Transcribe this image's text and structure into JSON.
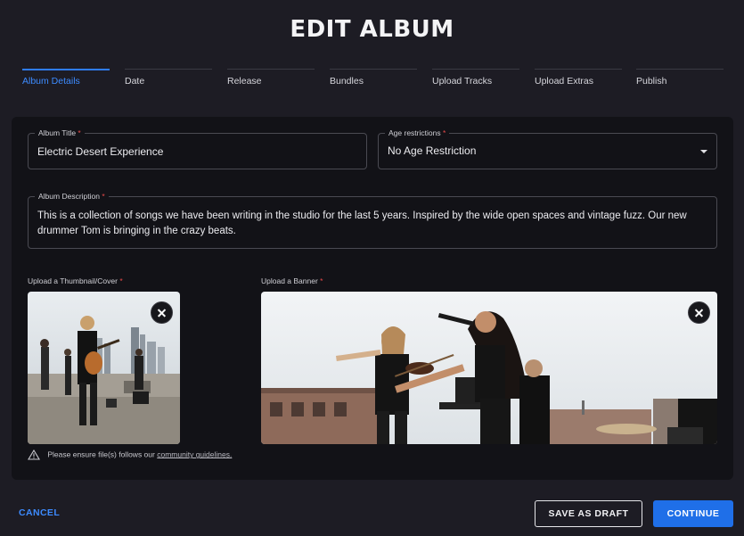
{
  "page": {
    "title": "EDIT ALBUM"
  },
  "steps": [
    {
      "label": "Album Details",
      "active": true
    },
    {
      "label": "Date"
    },
    {
      "label": "Release"
    },
    {
      "label": "Bundles"
    },
    {
      "label": "Upload Tracks"
    },
    {
      "label": "Upload Extras"
    },
    {
      "label": "Publish"
    }
  ],
  "form": {
    "album_title": {
      "label": "Album Title",
      "required": "*",
      "value": "Electric Desert Experience"
    },
    "age_restrictions": {
      "label": "Age restrictions",
      "required": "*",
      "value": "No Age Restriction"
    },
    "album_description": {
      "label": "Album Description",
      "required": "*",
      "value": "This is a collection of songs we have been writing in the studio for the last 5 years. Inspired by the wide open spaces and vintage fuzz. Our new drummer Tom is bringing in the crazy beats."
    },
    "thumbnail": {
      "label": "Upload a Thumbnail/Cover",
      "required": "*"
    },
    "banner": {
      "label": "Upload a Banner",
      "required": "*"
    }
  },
  "notice": {
    "text": "Please ensure file(s) follows our",
    "link": "community guidelines."
  },
  "footer": {
    "cancel": "CANCEL",
    "save_draft": "SAVE AS DRAFT",
    "continue": "CONTINUE"
  },
  "colors": {
    "accent": "#2f7cf6",
    "background": "#1d1c24",
    "card": "#121217",
    "required": "#e74a4a"
  }
}
